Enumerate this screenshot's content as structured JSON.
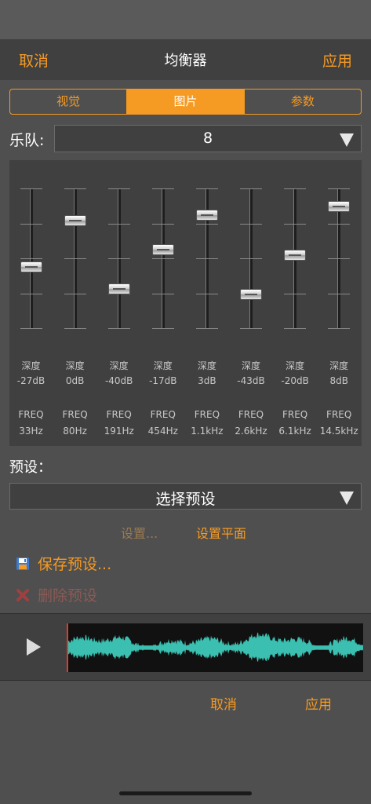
{
  "header": {
    "cancel": "取消",
    "title": "均衡器",
    "apply": "应用"
  },
  "tabs": [
    {
      "label": "视觉",
      "active": false
    },
    {
      "label": "图片",
      "active": true
    },
    {
      "label": "参数",
      "active": false
    }
  ],
  "band": {
    "label": "乐队:",
    "value": "8"
  },
  "sliders": [
    {
      "label": "深度",
      "gain": "-27dB",
      "freq_label": "FREQ",
      "freq": "33Hz",
      "level": 0.44
    },
    {
      "label": "深度",
      "gain": "0dB",
      "freq_label": "FREQ",
      "freq": "80Hz",
      "level": 0.77
    },
    {
      "label": "深度",
      "gain": "-40dB",
      "freq_label": "FREQ",
      "freq": "191Hz",
      "level": 0.28
    },
    {
      "label": "深度",
      "gain": "-17dB",
      "freq_label": "FREQ",
      "freq": "454Hz",
      "level": 0.56
    },
    {
      "label": "深度",
      "gain": "3dB",
      "freq_label": "FREQ",
      "freq": "1.1kHz",
      "level": 0.81
    },
    {
      "label": "深度",
      "gain": "-43dB",
      "freq_label": "FREQ",
      "freq": "2.6kHz",
      "level": 0.24
    },
    {
      "label": "深度",
      "gain": "-20dB",
      "freq_label": "FREQ",
      "freq": "6.1kHz",
      "level": 0.52
    },
    {
      "label": "深度",
      "gain": "8dB",
      "freq_label": "FREQ",
      "freq": "14.5kHz",
      "level": 0.87
    }
  ],
  "preset": {
    "label": "预设：",
    "select_value": "选择预设",
    "settings_link": "设置...",
    "flat_link": "设置平面",
    "save": "保存预设...",
    "delete": "删除预设"
  },
  "footer": {
    "cancel": "取消",
    "apply": "应用"
  },
  "colors": {
    "accent": "#f59a23",
    "waveform": "#3bbfb0",
    "playhead": "#e03a2a"
  }
}
